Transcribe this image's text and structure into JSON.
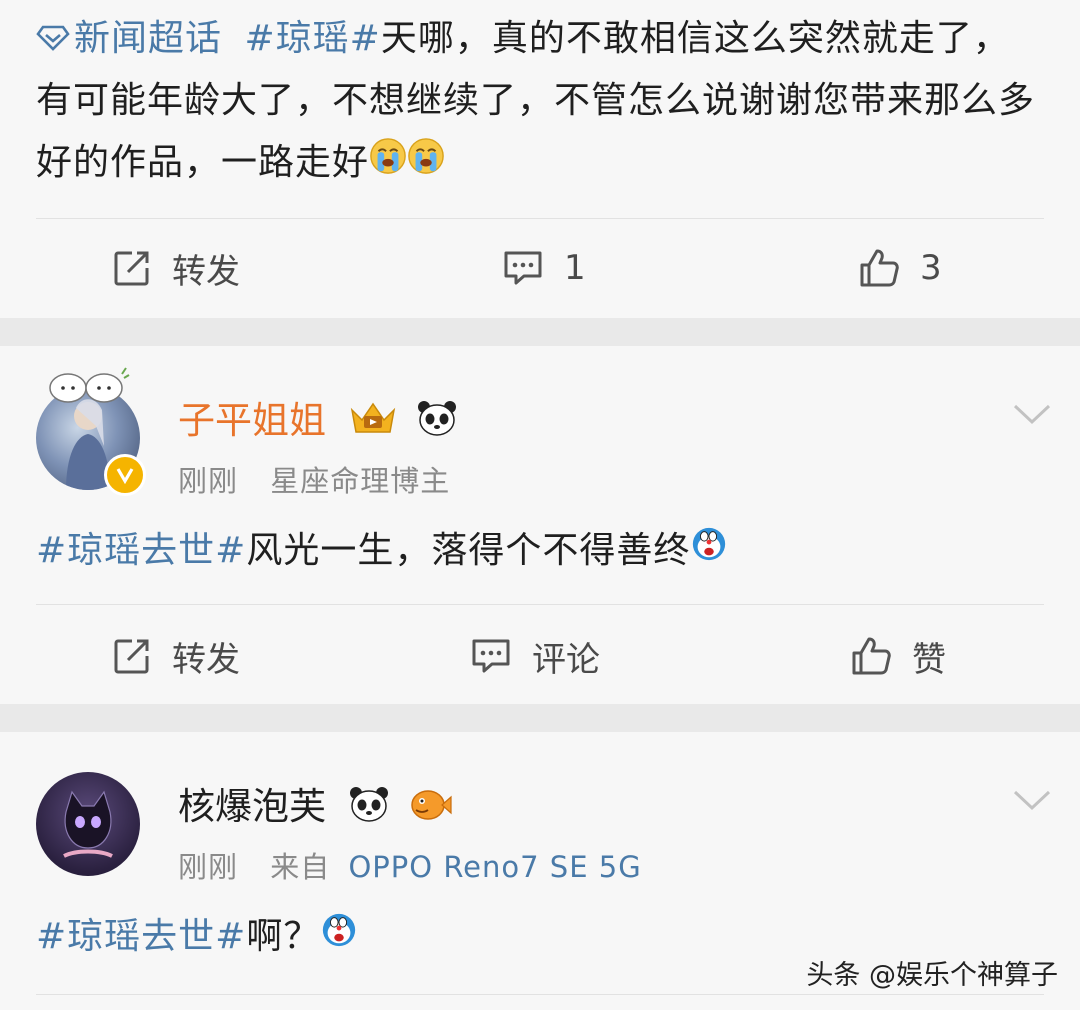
{
  "post1": {
    "supertopic_label": "新闻超话",
    "tag": "#琼瑶#",
    "text": "天哪，真的不敢相信这么突然就走了，有可能年龄大了，不想继续了，不管怎么说谢谢您带来那么多好的作品，一路走好",
    "emoji_icons": [
      "crying-face-icon",
      "crying-face-icon"
    ],
    "actions": {
      "repost_label": "转发",
      "comment_count": "1",
      "like_count": "3"
    }
  },
  "post2": {
    "username": "子平姐姐",
    "username_color": "#e8742b",
    "badges": [
      "crown-badge-icon",
      "panda-icon"
    ],
    "time": "刚刚",
    "bio": "星座命理博主",
    "tag": "#琼瑶去世#",
    "text": "风光一生，落得个不得善终",
    "emoji_icons": [
      "doraemon-icon"
    ],
    "actions": {
      "repost_label": "转发",
      "comment_label": "评论",
      "like_label": "赞"
    }
  },
  "post3": {
    "username": "核爆泡芙",
    "badges": [
      "panda-icon",
      "pufferfish-icon"
    ],
    "time": "刚刚",
    "source_prefix": "来自",
    "source_device": "OPPO Reno7 SE 5G",
    "tag": "#琼瑶去世#",
    "text": "啊？",
    "emoji_icons": [
      "doraemon-icon"
    ]
  },
  "watermark": "头条 @娱乐个神算子",
  "colors": {
    "link": "#4a7aa8",
    "verified": "#f5b400",
    "background": "#f7f7f7"
  }
}
